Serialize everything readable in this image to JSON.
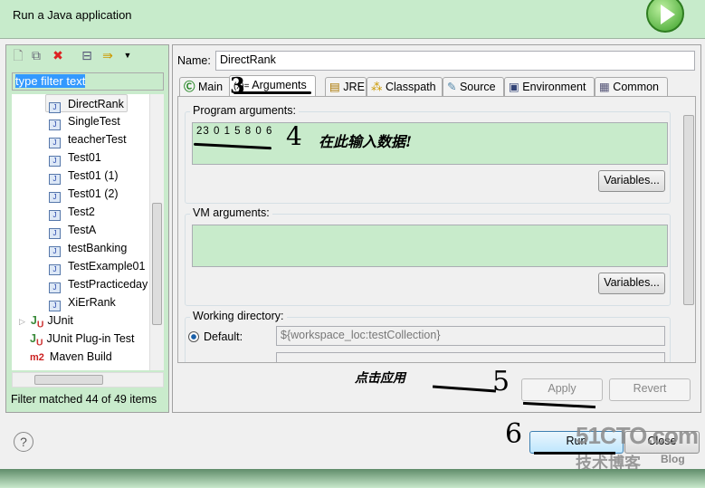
{
  "header": {
    "title": "Run a Java application",
    "logo_icon": "run-play-icon"
  },
  "left": {
    "toolbar": [
      "new-config-icon",
      "duplicate-icon",
      "delete-icon",
      "collapse-all-icon",
      "filter-icon",
      "dropdown-icon"
    ],
    "filter_value": "type filter text",
    "tree": [
      {
        "label": "DirectRank",
        "type": "java-app",
        "selected": true
      },
      {
        "label": "SingleTest",
        "type": "java-app"
      },
      {
        "label": "teacherTest",
        "type": "java-app"
      },
      {
        "label": "Test01",
        "type": "java-app"
      },
      {
        "label": "Test01 (1)",
        "type": "java-app"
      },
      {
        "label": "Test01 (2)",
        "type": "java-app"
      },
      {
        "label": "Test2",
        "type": "java-app"
      },
      {
        "label": "TestA",
        "type": "java-app"
      },
      {
        "label": "testBanking",
        "type": "java-app"
      },
      {
        "label": "TestExample01",
        "type": "java-app"
      },
      {
        "label": "TestPracticeday",
        "type": "java-app"
      },
      {
        "label": "XiErRank",
        "type": "java-app"
      },
      {
        "label": "JUnit",
        "type": "junit"
      },
      {
        "label": "JUnit Plug-in Test",
        "type": "junit-plugin"
      },
      {
        "label": "Maven Build",
        "type": "maven"
      }
    ],
    "status": "Filter matched 44 of 49 items"
  },
  "right": {
    "name_label": "Name:",
    "name_value": "DirectRank",
    "tabs": [
      {
        "label": "Main"
      },
      {
        "label": "Arguments",
        "active": true
      },
      {
        "label": "JRE"
      },
      {
        "label": "Classpath"
      },
      {
        "label": "Source"
      },
      {
        "label": "Environment"
      },
      {
        "label": "Common"
      }
    ],
    "program_args_label": "Program arguments:",
    "program_args_value": "23 0 1 5 8 0 6",
    "variables_label": "Variables...",
    "vm_args_label": "VM arguments:",
    "vm_args_value": "",
    "working_dir_label": "Working directory:",
    "default_label": "Default:",
    "default_value": "${workspace_loc:testCollection}",
    "apply_label": "Apply",
    "revert_label": "Revert"
  },
  "footer": {
    "run_label": "Run",
    "close_label": "Close"
  },
  "annotations": {
    "n3": "3",
    "n4": "4",
    "note4": "在此输入数据!",
    "note5": "点击应用",
    "n5": "5",
    "n6": "6"
  },
  "watermark": {
    "site": "51CTO.com",
    "sub": "技术博客",
    "blog": "Blog"
  }
}
